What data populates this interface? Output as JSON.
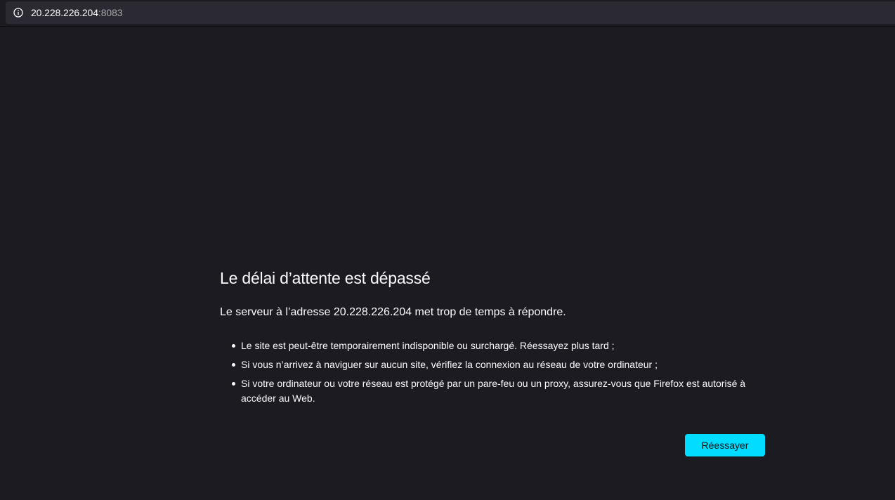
{
  "url_bar": {
    "host": "20.228.226.204",
    "port": ":8083",
    "icon": "info-icon"
  },
  "error": {
    "title": "Le délai d’attente est dépassé",
    "subtitle": "Le serveur à l’adresse 20.228.226.204 met trop de temps à répondre.",
    "suggestions": [
      "Le site est peut-être temporairement indisponible ou surchargé. Réessayez plus tard ;",
      "Si vous n’arrivez à naviguer sur aucun site, vérifiez la connexion au réseau de votre ordinateur ;",
      "Si votre ordinateur ou votre réseau est protégé par un pare-feu ou un proxy, assurez-vous que Firefox est autorisé à accéder au Web."
    ],
    "retry_label": "Réessayer"
  },
  "colors": {
    "background": "#1c1b22",
    "urlbar": "#2b2a33",
    "accent": "#00ddff",
    "text": "#fbfbfe"
  }
}
